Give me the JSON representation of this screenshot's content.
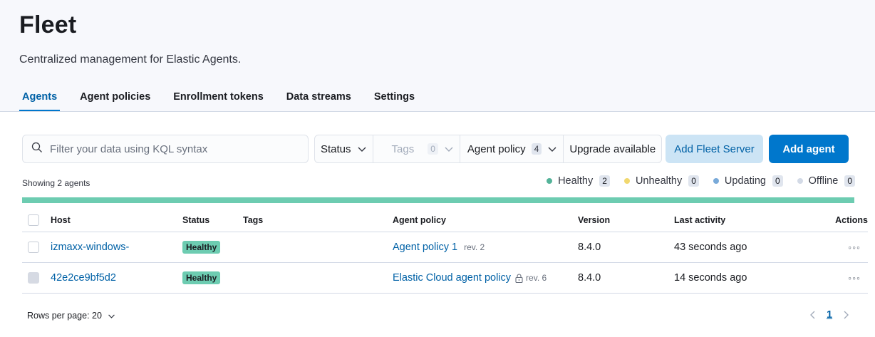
{
  "page": {
    "title": "Fleet",
    "subtitle": "Centralized management for Elastic Agents."
  },
  "tabs": [
    {
      "label": "Agents",
      "active": true
    },
    {
      "label": "Agent policies"
    },
    {
      "label": "Enrollment tokens"
    },
    {
      "label": "Data streams"
    },
    {
      "label": "Settings"
    }
  ],
  "search": {
    "placeholder": "Filter your data using KQL syntax",
    "value": ""
  },
  "filters": {
    "status": "Status",
    "tags": {
      "label": "Tags",
      "count": "0"
    },
    "agent_policy": {
      "label": "Agent policy",
      "count": "4"
    },
    "upgrade": "Upgrade available"
  },
  "buttons": {
    "add_fleet_server": "Add Fleet Server",
    "add_agent": "Add agent"
  },
  "summary": {
    "showing": "Showing 2 agents"
  },
  "legend": [
    {
      "label": "Healthy",
      "count": "2",
      "color": "#54b399"
    },
    {
      "label": "Unhealthy",
      "count": "0",
      "color": "#f1d86f"
    },
    {
      "label": "Updating",
      "count": "0",
      "color": "#79aad9"
    },
    {
      "label": "Offline",
      "count": "0",
      "color": "#d3dae6"
    }
  ],
  "health_bar": {
    "healthy_fraction": 1.0,
    "color": "#6dccb1"
  },
  "table": {
    "headers": {
      "host": "Host",
      "status": "Status",
      "tags": "Tags",
      "policy": "Agent policy",
      "version": "Version",
      "last_activity": "Last activity",
      "actions": "Actions"
    },
    "rows": [
      {
        "host": "izmaxx-windows-",
        "status": "Healthy",
        "policy": "Agent policy 1",
        "locked": false,
        "rev": "rev. 2",
        "version": "8.4.0",
        "last_activity": "43 seconds ago",
        "actions": "◦◦◦"
      },
      {
        "host": "42e2ce9bf5d2",
        "status": "Healthy",
        "policy": "Elastic Cloud agent policy",
        "locked": true,
        "rev": "rev. 6",
        "version": "8.4.0",
        "last_activity": "14 seconds ago",
        "actions": "◦◦◦"
      }
    ]
  },
  "pagination": {
    "rows_per_page": "Rows per page: 20",
    "current_page": "1"
  }
}
